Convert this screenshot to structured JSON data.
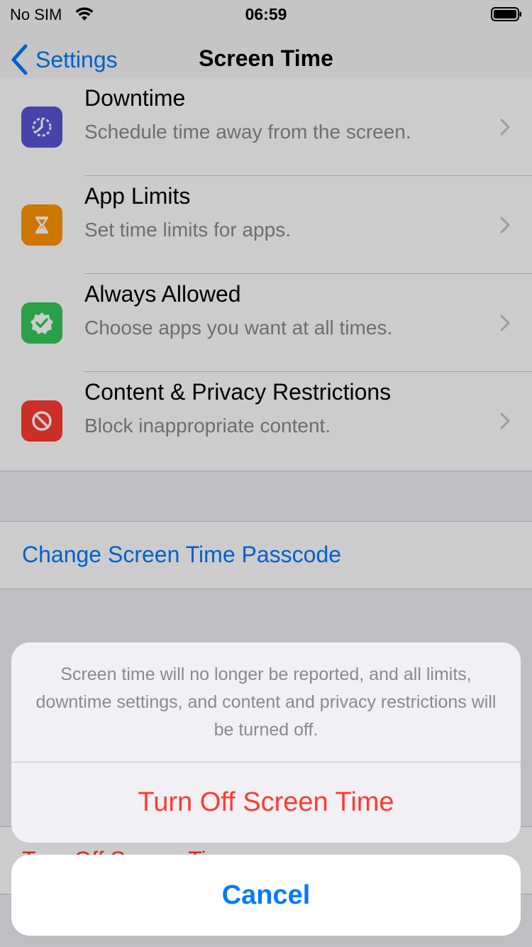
{
  "status_bar": {
    "carrier": "No SIM",
    "time": "06:59"
  },
  "nav": {
    "back_label": "Settings",
    "title": "Screen Time"
  },
  "settings_rows": [
    {
      "title": "Downtime",
      "subtitle": "Schedule time away from the screen.",
      "icon": "downtime-icon",
      "color": "#5856d6"
    },
    {
      "title": "App Limits",
      "subtitle": "Set time limits for apps.",
      "icon": "hourglass-icon",
      "color": "#ff9500"
    },
    {
      "title": "Always Allowed",
      "subtitle": "Choose apps you want at all times.",
      "icon": "checkmark-badge-icon",
      "color": "#34c759"
    },
    {
      "title": "Content & Privacy Restrictions",
      "subtitle": "Block inappropriate content.",
      "icon": "prohibited-icon",
      "color": "#ff3b30"
    }
  ],
  "passcode_link": "Change Screen Time Passcode",
  "turn_off_row": "Turn Off Screen Time",
  "action_sheet": {
    "message": "Screen time will no longer be reported, and all limits, downtime settings, and content and privacy restrictions will be turned off.",
    "destructive_label": "Turn Off Screen Time",
    "cancel_label": "Cancel"
  },
  "colors": {
    "accent": "#007aff",
    "destructive": "#ff3b30"
  }
}
